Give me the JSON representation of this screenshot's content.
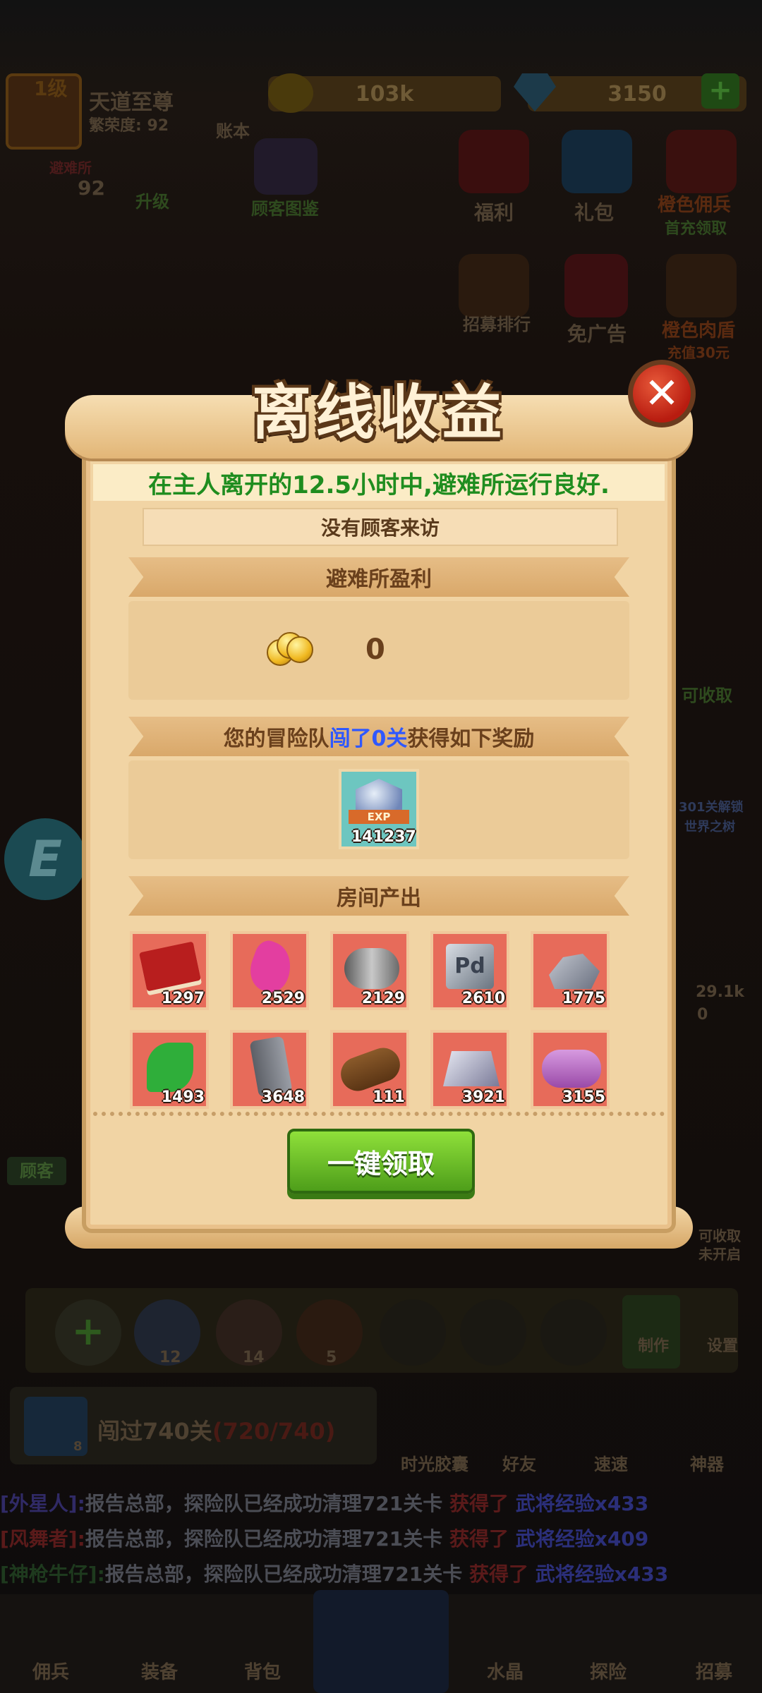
{
  "background": {
    "player": {
      "name": "天道至尊",
      "level_tag": "1级",
      "fame": "繁荣度: 92",
      "book_label": "账本"
    },
    "gold": "103k",
    "gems": "3150",
    "shelter": {
      "label": "避难所",
      "value": "92",
      "upgrade": "升级"
    },
    "icons": [
      {
        "label": "顾客图鉴"
      },
      {
        "label": "福利"
      },
      {
        "label": "礼包"
      },
      {
        "label": "橙色佣兵",
        "sub": "首充领取"
      },
      {
        "label": "招募排行"
      },
      {
        "label": "免广告"
      },
      {
        "label": "橙色肉盾",
        "sub": "充值30元"
      }
    ],
    "side": {
      "collect": "可收取",
      "reward_lines": [
        "301关解锁",
        "世界之树"
      ],
      "right_values": [
        "29.1k",
        "0"
      ],
      "customer": "顾客",
      "pet_lines": [
        "可收取",
        "未开启"
      ],
      "e_label": "E"
    },
    "bottom_slots": [
      {
        "value": "12"
      },
      {
        "value": "14"
      },
      {
        "value": "5"
      }
    ],
    "make_label": "制作",
    "settings_label": "设置",
    "stage": {
      "gem_count": "8",
      "text": "闯过740关",
      "progress": "(720/740)"
    },
    "features": [
      "时光胶囊",
      "好友",
      "速速",
      "神器"
    ],
    "chat": [
      {
        "name": "[外星人]:",
        "msg": "报告总部，探险队已经成功清理721关卡",
        "got": "获得了",
        "reward": "武将经验x433"
      },
      {
        "name": "[风舞者]:",
        "msg": "报告总部，探险队已经成功清理721关卡",
        "got": "获得了",
        "reward": "武将经验x409"
      },
      {
        "name": "[神枪牛仔]:",
        "msg": "报告总部，探险队已经成功清理721关卡",
        "got": "获得了",
        "reward": "武将经验x433"
      }
    ],
    "nav": [
      "佣兵",
      "装备",
      "背包",
      "",
      "水晶",
      "探险",
      "招募"
    ]
  },
  "dialog": {
    "title": "离线收益",
    "close": "✕",
    "summary": "在主人离开的12.5小时中,避难所运行良好.",
    "no_visitors": "没有顾客来访",
    "profit_header": "避难所盈利",
    "profit_value": "0",
    "adventure_prefix": "您的冒险队",
    "adventure_highlight": "闯了0关",
    "adventure_suffix": "获得如下奖励",
    "exp_label": "EXP",
    "exp_value": "141237",
    "room_header": "房间产出",
    "items": [
      {
        "name": "book-icon",
        "count": "1297"
      },
      {
        "name": "ribbon-icon",
        "count": "2529"
      },
      {
        "name": "steel-roll-icon",
        "count": "2129"
      },
      {
        "name": "palladium-cube-icon",
        "count": "2610"
      },
      {
        "name": "stone-icon",
        "count": "1775"
      },
      {
        "name": "herb-icon",
        "count": "1493"
      },
      {
        "name": "stone-slab-icon",
        "count": "3648"
      },
      {
        "name": "wood-log-icon",
        "count": "111"
      },
      {
        "name": "silver-ingot-icon",
        "count": "3921"
      },
      {
        "name": "cloth-roll-icon",
        "count": "3155"
      }
    ],
    "claim_button": "一键领取",
    "accent": "#1f8d1f",
    "highlight_color": "#2f58ff"
  }
}
